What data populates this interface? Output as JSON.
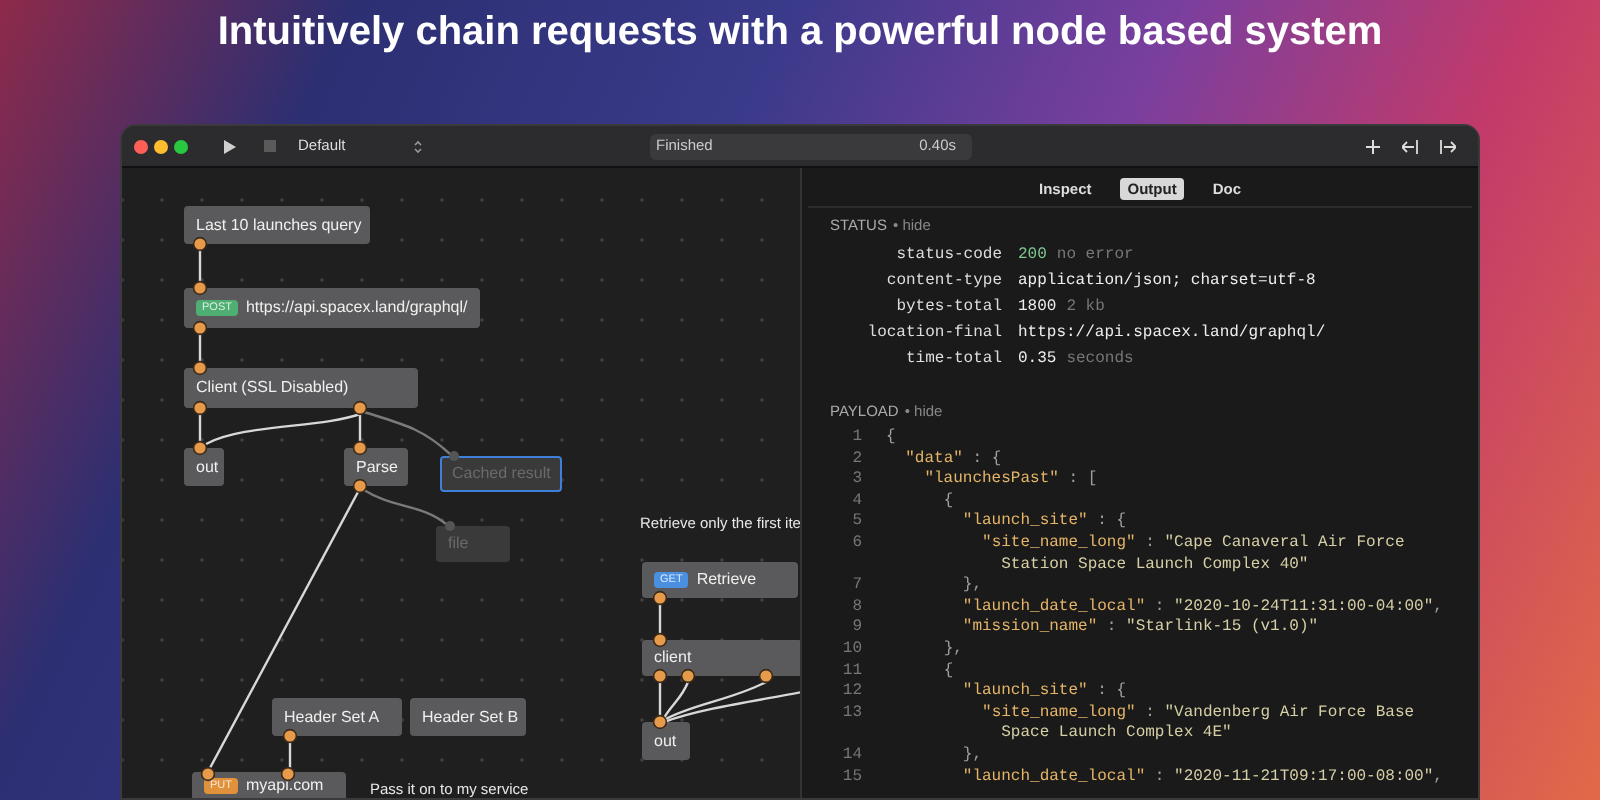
{
  "headline": "Intuitively chain requests with a powerful node based system",
  "toolbar": {
    "scheme": "Default",
    "status": "Finished",
    "duration": "0.40s"
  },
  "canvas": {
    "nodes": [
      {
        "kind": "block",
        "label": "Last 10 launches query",
        "selected": false,
        "disabled": false
      },
      {
        "kind": "request",
        "method": "POST",
        "color": "#4fae72",
        "label": "https://api.spacex.land/graphql/",
        "selected": false,
        "disabled": false
      },
      {
        "kind": "block",
        "label": "Client (SSL Disabled)",
        "selected": false,
        "disabled": false
      },
      {
        "kind": "block",
        "label": "out",
        "selected": false,
        "disabled": false
      },
      {
        "kind": "block",
        "label": "Parse",
        "selected": false,
        "disabled": false
      },
      {
        "kind": "block",
        "label": "Cached result",
        "selected": true,
        "disabled": true
      },
      {
        "kind": "block",
        "label": "file",
        "selected": false,
        "disabled": true
      },
      {
        "kind": "block",
        "label": "Header Set A",
        "selected": false,
        "disabled": false
      },
      {
        "kind": "block",
        "label": "Header Set B",
        "selected": false,
        "disabled": false
      },
      {
        "kind": "request",
        "method": "PUT",
        "color": "#e0913a",
        "label": "myapi.com",
        "selected": false,
        "disabled": false
      },
      {
        "kind": "request",
        "method": "GET",
        "color": "#4a8fe0",
        "label": "Retrieve",
        "selected": false,
        "disabled": false
      },
      {
        "kind": "block",
        "label": "client",
        "selected": false,
        "disabled": false
      },
      {
        "kind": "block",
        "label": "out",
        "selected": false,
        "disabled": false
      }
    ],
    "notes": [
      "Retrieve only the first ite",
      "Pass it on to my service"
    ]
  },
  "panel": {
    "tabs": [
      {
        "label": "Inspect",
        "selected": false
      },
      {
        "label": "Output",
        "selected": true
      },
      {
        "label": "Doc",
        "selected": false
      }
    ],
    "status": {
      "title": "STATUS",
      "toggle": "• hide",
      "rows": [
        {
          "key": "status-code",
          "value": "200",
          "detail": "no error",
          "kind": "ok"
        },
        {
          "key": "content-type",
          "value": "application/json; charset=utf-8",
          "kind": "plain"
        },
        {
          "key": "bytes-total",
          "value": "1800",
          "detail": "2 kb",
          "kind": "plain"
        },
        {
          "key": "location-final",
          "value": "https://api.spacex.land/graphql/",
          "kind": "plain"
        },
        {
          "key": "time-total",
          "value": "0.35",
          "detail": "seconds",
          "kind": "plain"
        }
      ]
    },
    "payload": {
      "title": "PAYLOAD",
      "toggle": "• hide",
      "lines": [
        {
          "number": "1",
          "tokens": [
            {
              "kind": "punct",
              "text": "{"
            }
          ]
        },
        {
          "number": "2",
          "tokens": [
            {
              "kind": "key",
              "text": "  \"data\""
            },
            {
              "kind": "punct",
              "text": " : {"
            }
          ]
        },
        {
          "number": "3",
          "tokens": [
            {
              "kind": "key",
              "text": "    \"launchesPast\""
            },
            {
              "kind": "punct",
              "text": " : ["
            }
          ]
        },
        {
          "number": "4",
          "tokens": [
            {
              "kind": "punct",
              "text": "      {"
            }
          ]
        },
        {
          "number": "5",
          "tokens": [
            {
              "kind": "key",
              "text": "        \"launch_site\""
            },
            {
              "kind": "punct",
              "text": " : {"
            }
          ]
        },
        {
          "number": "6",
          "tokens": [
            {
              "kind": "key",
              "text": "          \"site_name_long\""
            },
            {
              "kind": "punct",
              "text": " : "
            },
            {
              "kind": "string",
              "text": "\"Cape Canaveral Air Force Station Space Launch Complex 40\""
            }
          ]
        },
        {
          "number": "7",
          "tokens": [
            {
              "kind": "punct",
              "text": "        },"
            }
          ]
        },
        {
          "number": "8",
          "tokens": [
            {
              "kind": "key",
              "text": "        \"launch_date_local\""
            },
            {
              "kind": "punct",
              "text": " : "
            },
            {
              "kind": "string",
              "text": "\"2020-10-24T11:31:00-04:00\""
            },
            {
              "kind": "punct",
              "text": ","
            }
          ]
        },
        {
          "number": "9",
          "tokens": [
            {
              "kind": "key",
              "text": "        \"mission_name\""
            },
            {
              "kind": "punct",
              "text": " : "
            },
            {
              "kind": "string",
              "text": "\"Starlink-15 (v1.0)\""
            }
          ]
        },
        {
          "number": "10",
          "tokens": [
            {
              "kind": "punct",
              "text": "      },"
            }
          ]
        },
        {
          "number": "11",
          "tokens": [
            {
              "kind": "punct",
              "text": "      {"
            }
          ]
        },
        {
          "number": "12",
          "tokens": [
            {
              "kind": "key",
              "text": "        \"launch_site\""
            },
            {
              "kind": "punct",
              "text": " : {"
            }
          ]
        },
        {
          "number": "13",
          "tokens": [
            {
              "kind": "key",
              "text": "          \"site_name_long\""
            },
            {
              "kind": "punct",
              "text": " : "
            },
            {
              "kind": "string",
              "text": "\"Vandenberg Air Force Base Space Launch Complex 4E\""
            }
          ]
        },
        {
          "number": "14",
          "tokens": [
            {
              "kind": "punct",
              "text": "        },"
            }
          ]
        },
        {
          "number": "15",
          "tokens": [
            {
              "kind": "key",
              "text": "        \"launch_date_local\""
            },
            {
              "kind": "punct",
              "text": " : "
            },
            {
              "kind": "string",
              "text": "\"2020-11-21T09:17:00-08:00\""
            },
            {
              "kind": "punct",
              "text": ","
            }
          ]
        }
      ]
    }
  }
}
